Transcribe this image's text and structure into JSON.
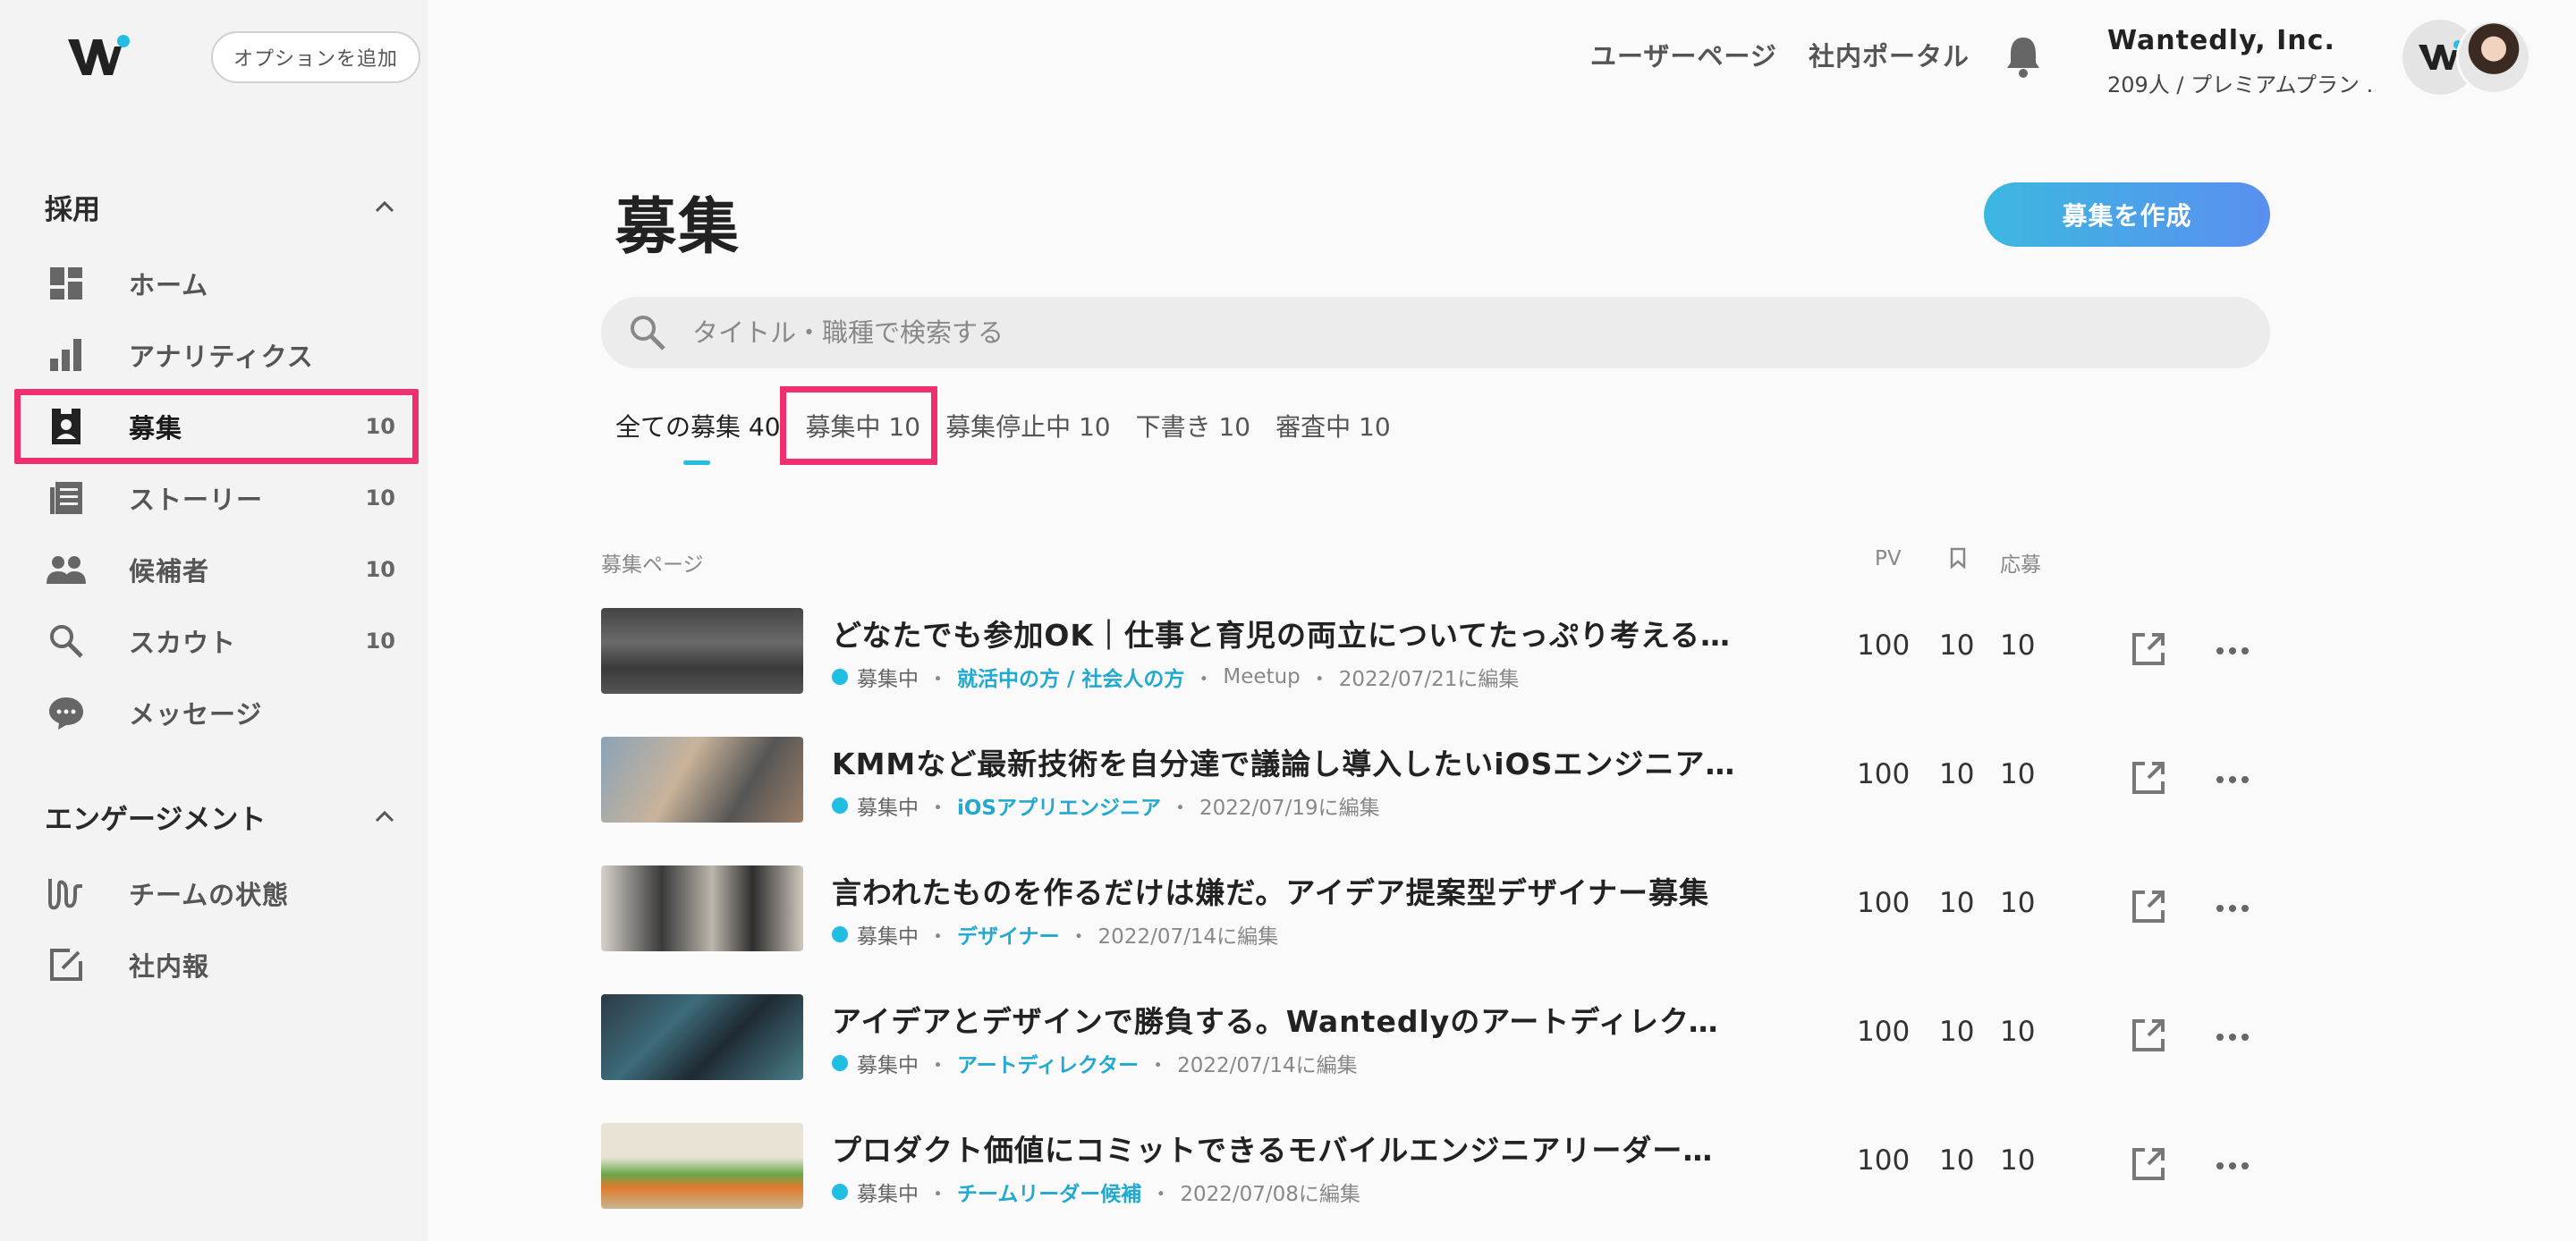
{
  "header": {
    "option_button": "オプションを追加",
    "links": [
      "ユーザーページ",
      "社内ポータル"
    ],
    "company_name": "Wantedly, Inc.",
    "company_plan": "209人 / プレミアムプラン ..."
  },
  "sidebar": {
    "sections": [
      {
        "title": "採用"
      },
      {
        "title": "エンゲージメント"
      }
    ],
    "items": [
      {
        "label": "ホーム",
        "count": "",
        "icon": "dashboard-icon"
      },
      {
        "label": "アナリティクス",
        "count": "",
        "icon": "bar-chart-icon"
      },
      {
        "label": "募集",
        "count": "10",
        "icon": "badge-icon"
      },
      {
        "label": "ストーリー",
        "count": "10",
        "icon": "article-icon"
      },
      {
        "label": "候補者",
        "count": "10",
        "icon": "people-icon"
      },
      {
        "label": "スカウト",
        "count": "10",
        "icon": "search-icon"
      },
      {
        "label": "メッセージ",
        "count": "",
        "icon": "chat-icon"
      },
      {
        "label": "チームの状態",
        "count": "",
        "icon": "wave-icon"
      },
      {
        "label": "社内報",
        "count": "",
        "icon": "edit-icon"
      }
    ]
  },
  "main": {
    "title": "募集",
    "create_button": "募集を作成",
    "search_placeholder": "タイトル・職種で検索する",
    "tabs": [
      {
        "label": "全ての募集 40"
      },
      {
        "label": "募集中 10"
      },
      {
        "label": "募集停止中 10"
      },
      {
        "label": "下書き 10"
      },
      {
        "label": "審査中 10"
      }
    ],
    "columns": {
      "page": "募集ページ",
      "pv": "PV",
      "apply": "応募"
    },
    "rows": [
      {
        "title": "どなたでも参加OK｜仕事と育児の両立についてたっぷり考えるMeetup",
        "status": "募集中",
        "tag": "就活中の方 / 社会人の方",
        "type": "Meetup",
        "edited": "2022/07/21に編集",
        "pv": "100",
        "bookmarks": "10",
        "applies": "10"
      },
      {
        "title": "KMMなど最新技術を自分達で議論し導入したいiOSエンジニア募集！",
        "status": "募集中",
        "tag": "iOSアプリエンジニア",
        "type": "",
        "edited": "2022/07/19に編集",
        "pv": "100",
        "bookmarks": "10",
        "applies": "10"
      },
      {
        "title": "言われたものを作るだけは嫌だ。アイデア提案型デザイナー募集",
        "status": "募集中",
        "tag": "デザイナー",
        "type": "",
        "edited": "2022/07/14に編集",
        "pv": "100",
        "bookmarks": "10",
        "applies": "10"
      },
      {
        "title": "アイデアとデザインで勝負する。Wantedlyのアートディレクター募集",
        "status": "募集中",
        "tag": "アートディレクター",
        "type": "",
        "edited": "2022/07/14に編集",
        "pv": "100",
        "bookmarks": "10",
        "applies": "10"
      },
      {
        "title": "プロダクト価値にコミットできるモバイルエンジニアリーダーWantedly",
        "status": "募集中",
        "tag": "チームリーダー候補",
        "type": "",
        "edited": "2022/07/08に編集",
        "pv": "100",
        "bookmarks": "10",
        "applies": "10"
      }
    ]
  },
  "colors": {
    "accent": "#21bde3",
    "highlight": "#f0306e",
    "button_gradient_start": "#3cb8e0",
    "button_gradient_end": "#5a8ff0"
  }
}
